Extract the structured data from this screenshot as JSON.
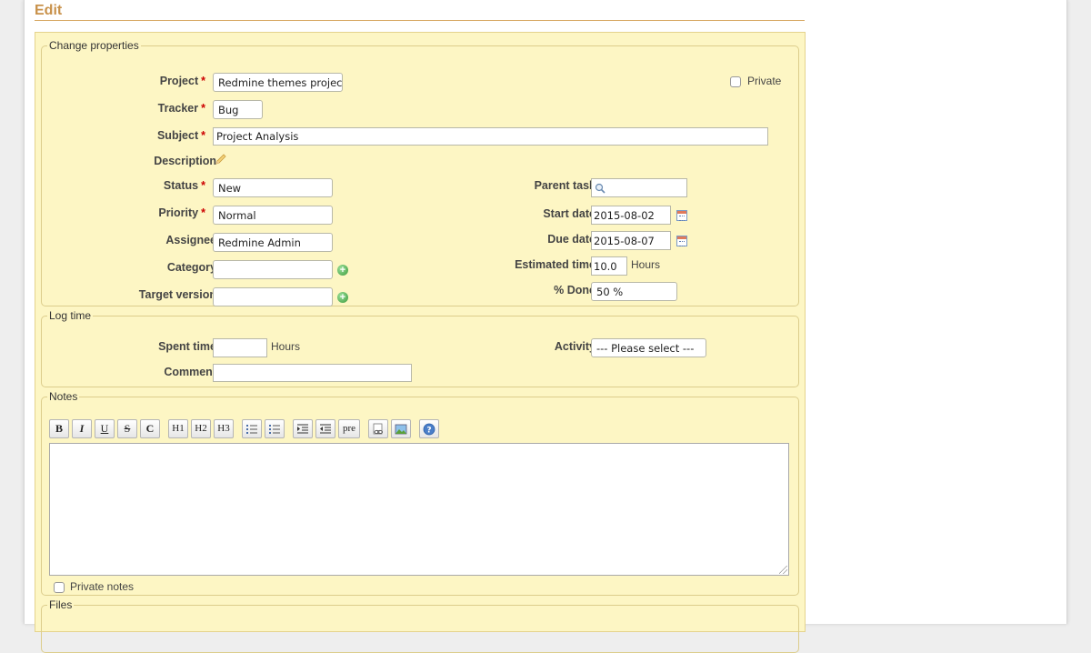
{
  "page": {
    "title": "Edit"
  },
  "properties": {
    "legend": "Change properties",
    "project": {
      "label": "Project",
      "value": "Redmine themes project"
    },
    "private": {
      "label": "Private"
    },
    "tracker": {
      "label": "Tracker",
      "value": "Bug"
    },
    "subject": {
      "label": "Subject",
      "value": "Project Analysis"
    },
    "description": {
      "label": "Description"
    },
    "status": {
      "label": "Status",
      "value": "New"
    },
    "priority": {
      "label": "Priority",
      "value": "Normal"
    },
    "assignee": {
      "label": "Assignee",
      "value": "Redmine Admin"
    },
    "category": {
      "label": "Category",
      "value": ""
    },
    "target_version": {
      "label": "Target version",
      "value": ""
    },
    "parent_task": {
      "label": "Parent task",
      "value": ""
    },
    "start_date": {
      "label": "Start date",
      "value": "2015-08-02"
    },
    "due_date": {
      "label": "Due date",
      "value": "2015-08-07"
    },
    "estimated_time": {
      "label": "Estimated time",
      "value": "10.0",
      "unit": "Hours"
    },
    "done_ratio": {
      "label": "% Done",
      "value": "50 %"
    },
    "required_marker": "*"
  },
  "log_time": {
    "legend": "Log time",
    "spent_time": {
      "label": "Spent time",
      "value": "",
      "unit": "Hours"
    },
    "activity": {
      "label": "Activity",
      "value": "--- Please select ---"
    },
    "comment": {
      "label": "Comment",
      "value": ""
    }
  },
  "notes": {
    "legend": "Notes",
    "toolbar": {
      "bold": "B",
      "italic": "I",
      "underline": "U",
      "strike": "S",
      "code": "C",
      "h1": "H1",
      "h2": "H2",
      "h3": "H3",
      "pre": "pre"
    },
    "private_notes": {
      "label": "Private notes"
    }
  },
  "files": {
    "legend": "Files"
  },
  "colors": {
    "title": "#c8914a",
    "box_background": "#fdf6c4",
    "required": "#cc0000"
  },
  "icons": [
    "pencil-icon",
    "add-icon",
    "search-icon",
    "calendar-icon",
    "link-icon",
    "image-icon",
    "help-icon"
  ]
}
